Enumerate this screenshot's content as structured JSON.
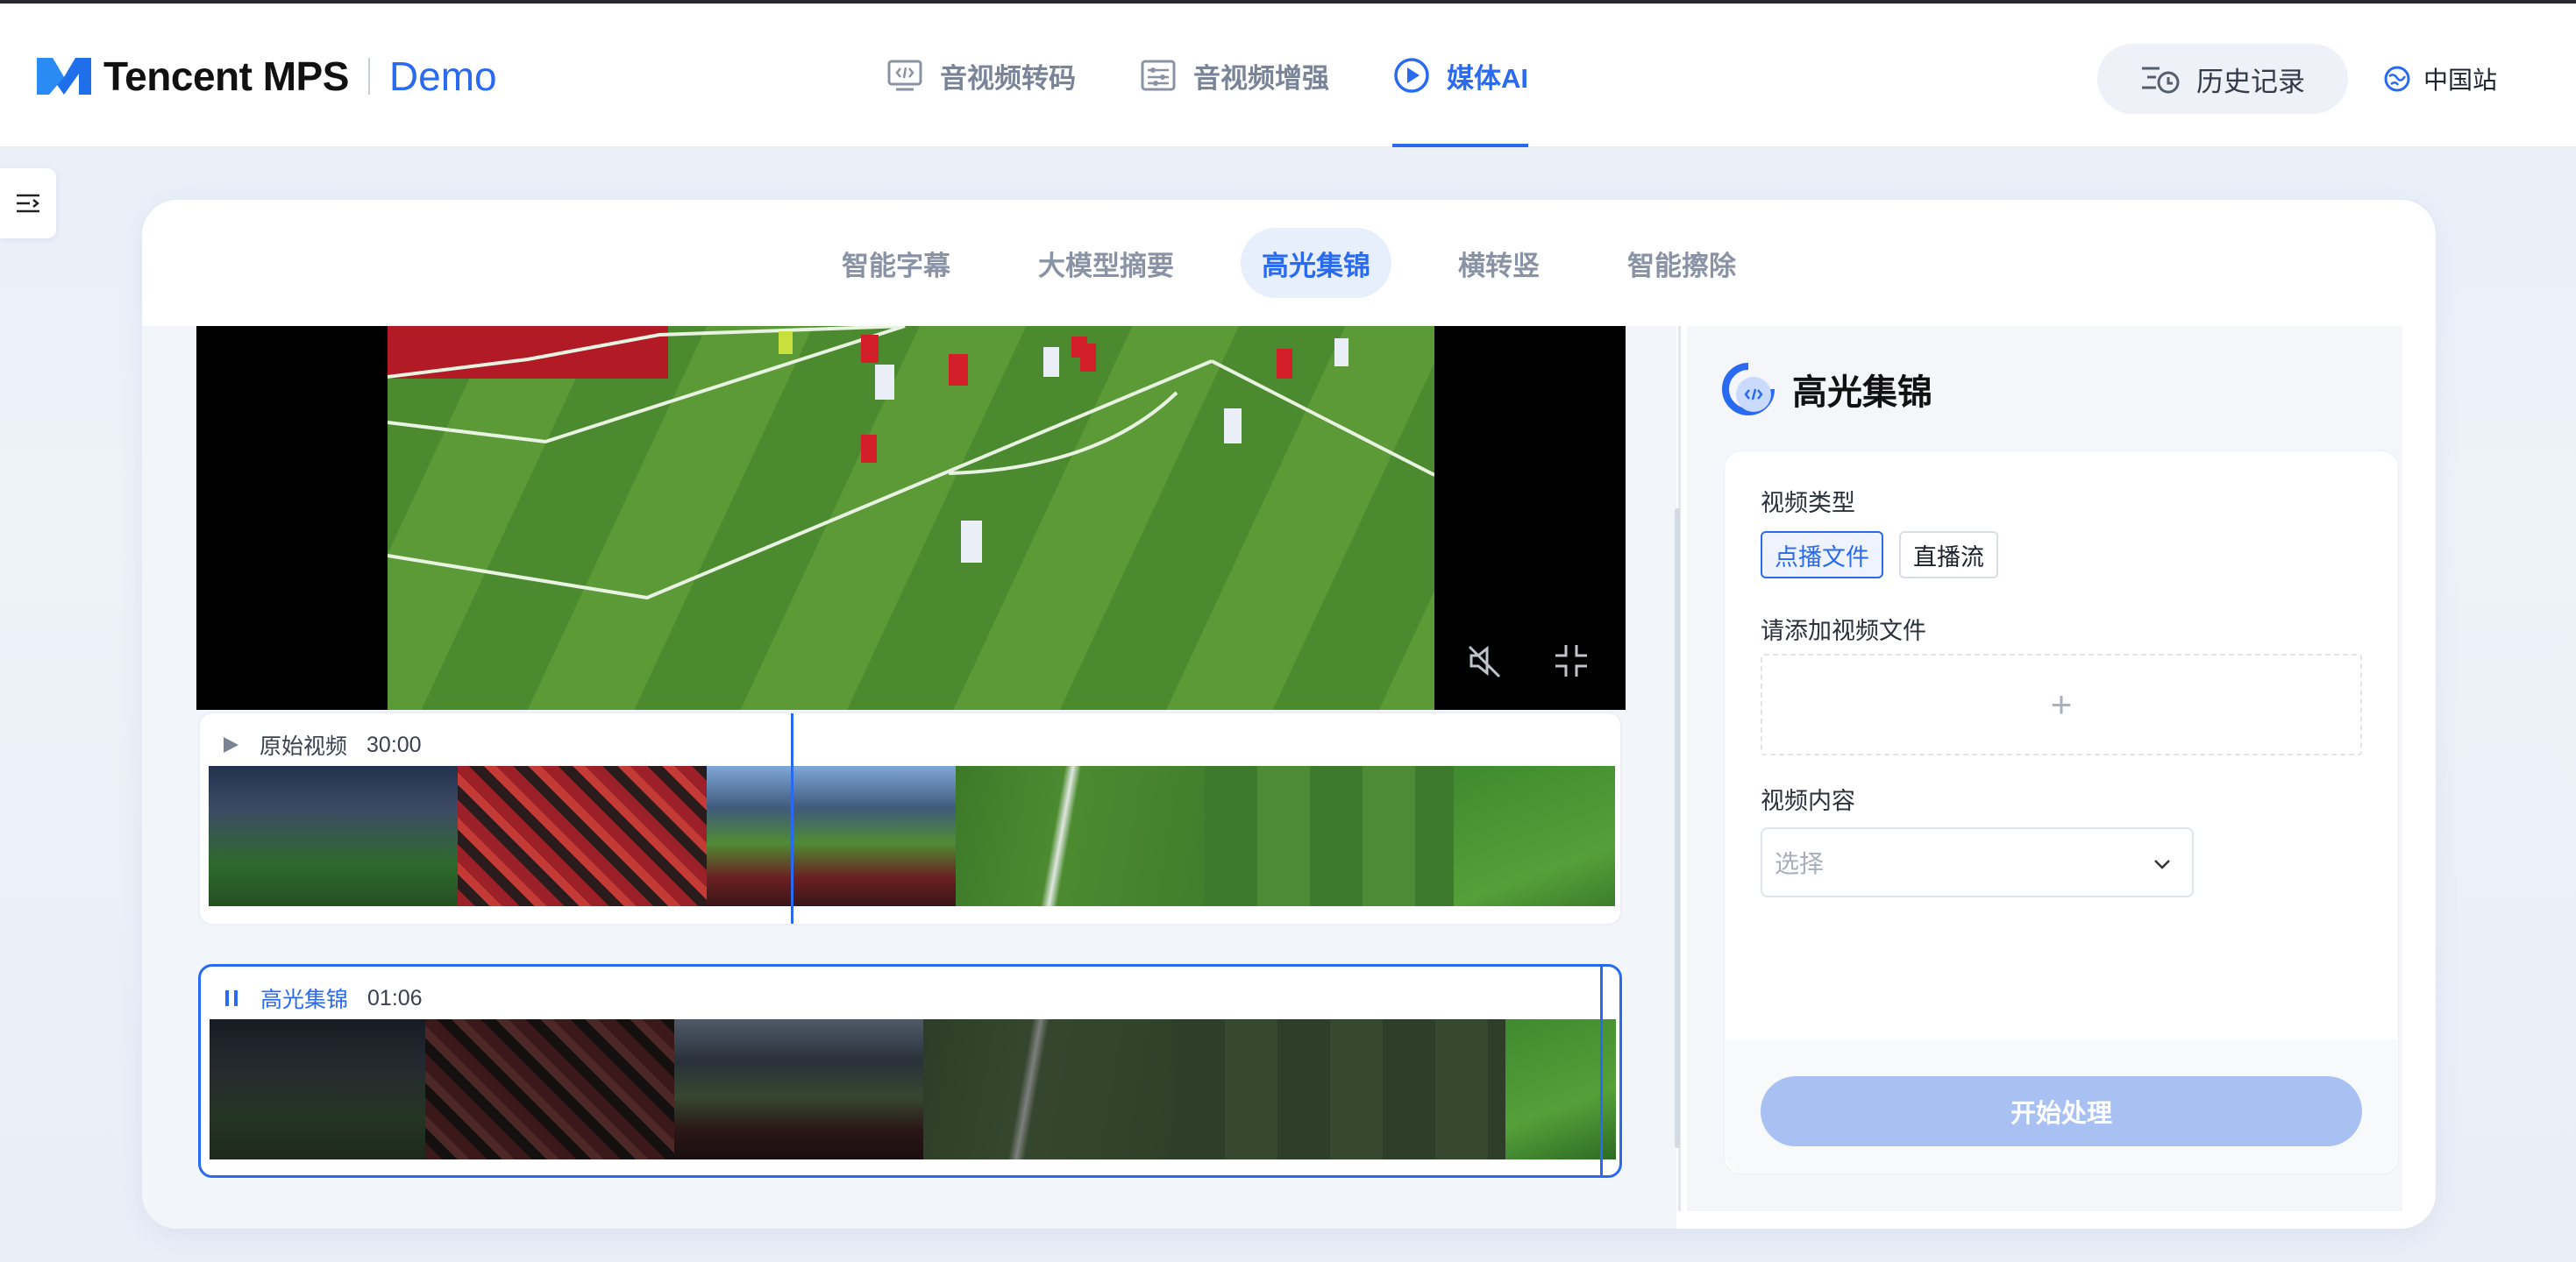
{
  "app": {
    "brand": "Tencent MPS",
    "demo": "Demo"
  },
  "nav": {
    "items": [
      {
        "label": "音视频转码",
        "icon": "transcode-icon"
      },
      {
        "label": "音视频增强",
        "icon": "enhance-icon"
      },
      {
        "label": "媒体AI",
        "icon": "media-ai-icon",
        "active": true
      }
    ]
  },
  "header": {
    "history_label": "历史记录",
    "region_label": "中国站"
  },
  "subtabs": [
    {
      "label": "智能字幕"
    },
    {
      "label": "大模型摘要"
    },
    {
      "label": "高光集锦",
      "active": true
    },
    {
      "label": "横转竖"
    },
    {
      "label": "智能擦除"
    }
  ],
  "tracks": {
    "original": {
      "label": "原始视频",
      "time": "30:00"
    },
    "highlight": {
      "label": "高光集锦",
      "time": "01:06"
    }
  },
  "panel": {
    "title": "高光集锦",
    "video_type_label": "视频类型",
    "video_type_options": [
      "点播文件",
      "直播流"
    ],
    "video_type_selected": "点播文件",
    "add_file_label": "请添加视频文件",
    "add_symbol": "+",
    "content_label": "视频内容",
    "content_placeholder": "选择",
    "start_label": "开始处理"
  },
  "colors": {
    "accent": "#2a6af0",
    "start_button_disabled": "#a9c0f3"
  }
}
